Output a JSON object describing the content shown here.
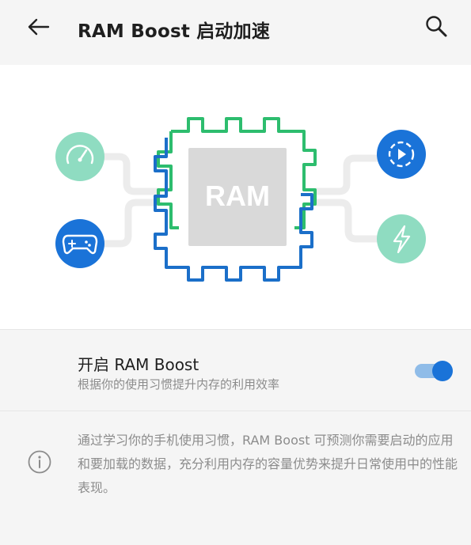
{
  "header": {
    "title": "RAM Boost 启动加速",
    "back_icon": "arrow-left-icon",
    "search_icon": "search-icon"
  },
  "hero": {
    "chip_label": "RAM",
    "icons": [
      "speedometer-icon",
      "gamepad-icon",
      "play-circle-icon",
      "lightning-icon"
    ],
    "colors": {
      "chip_green": "#2dbd6e",
      "chip_blue": "#1b6fc9",
      "chip_core": "#d9d9d9",
      "circle_mint": "#8fdcc1",
      "circle_blue": "#1a73d8"
    }
  },
  "toggle": {
    "title": "开启 RAM Boost",
    "subtitle": "根据你的使用习惯提升内存的利用效率",
    "enabled": true,
    "accent": "#1a73d8"
  },
  "info": {
    "icon": "info-icon",
    "text": "通过学习你的手机使用习惯，RAM Boost 可预测你需要启动的应用和要加载的数据，充分利用内存的容量优势来提升日常使用中的性能表现。"
  }
}
